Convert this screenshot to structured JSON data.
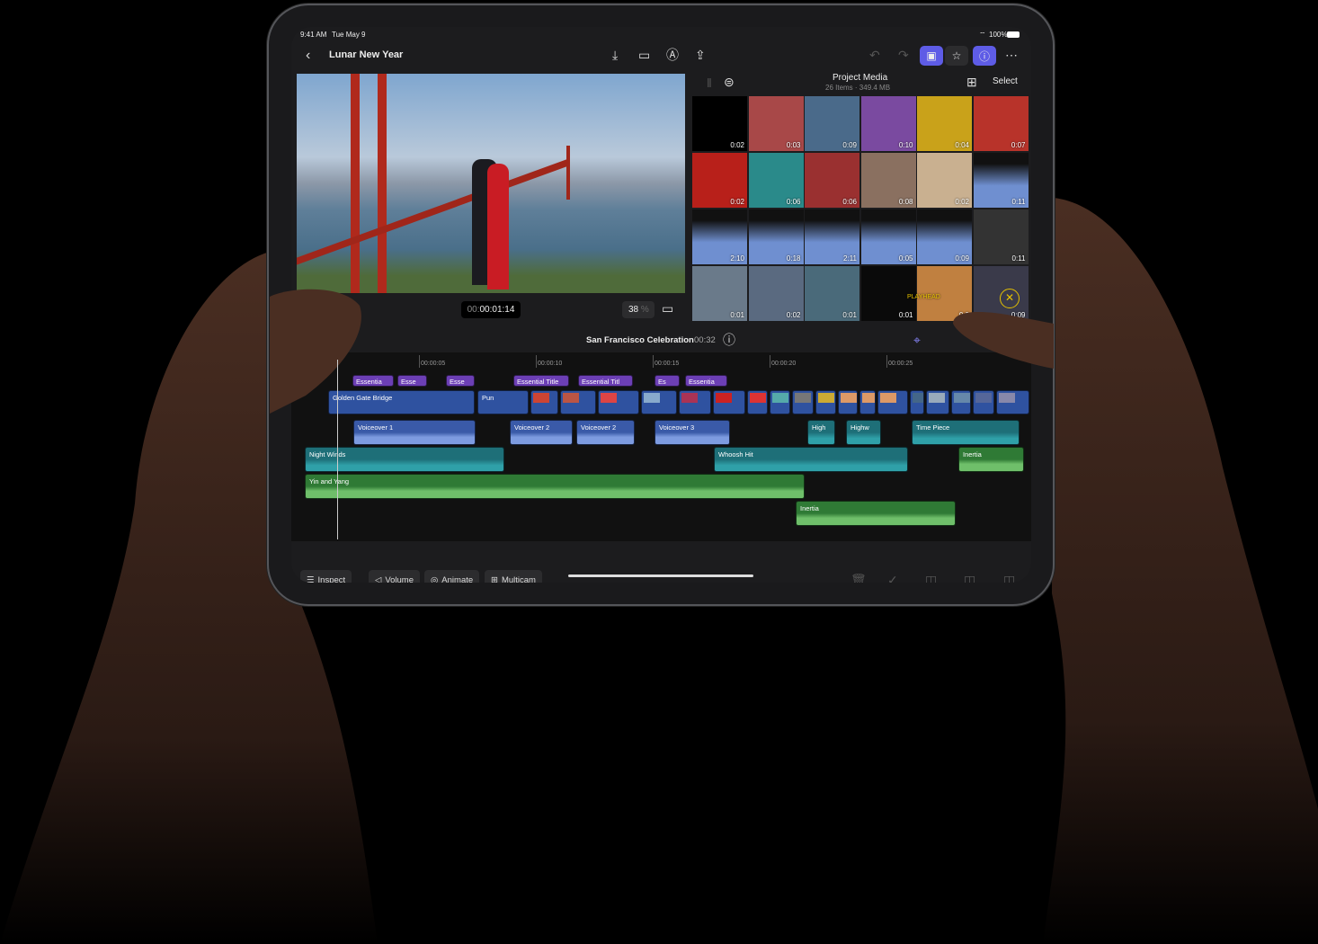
{
  "status": {
    "time": "9:41 AM",
    "date": "Tue May 9",
    "battery": "100%"
  },
  "toolbar": {
    "back": "back",
    "title": "Lunar New Year",
    "icons": [
      "import-icon",
      "camera-icon",
      "pencil-icon",
      "share-icon",
      "undo-icon",
      "redo-icon",
      "photos-icon",
      "titles-icon",
      "inspector-icon",
      "more-icon"
    ]
  },
  "viewer": {
    "timecode_dim": "00:",
    "timecode": "00:01:14",
    "zoom": "38",
    "zoom_unit": "%"
  },
  "browser": {
    "title": "Project Media",
    "subtitle": "26 Items · 349.4 MB",
    "select": "Select",
    "durations": [
      "0:02",
      "0:03",
      "0:09",
      "0:10",
      "0:04",
      "0:07",
      "0:02",
      "0:06",
      "0:06",
      "0:08",
      "0:02",
      "0:11",
      "2:10",
      "0:18",
      "2:11",
      "0:05",
      "0:09",
      "0:11",
      "0:01",
      "0:02",
      "0:01",
      "0:01",
      "0:0",
      "0:09"
    ],
    "playhead_label": "PLAYHEAD"
  },
  "timeline": {
    "project": "San Francisco Celebration",
    "duration": "00:32",
    "ruler": [
      "00:00:05",
      "00:00:10",
      "00:00:15",
      "00:00:20",
      "00:00:25"
    ],
    "titles": [
      "Essentia",
      "Esse",
      "Esse",
      "Essential Title",
      "Essential Titl",
      "Es",
      "Essentia"
    ],
    "video": [
      "Golden Gate Bridge",
      "Pun"
    ],
    "voiceovers": [
      "Voiceover 1",
      "Voiceover 2",
      "Voiceover 2",
      "Voiceover 3"
    ],
    "effects": [
      "High",
      "Highw",
      "Time Piece",
      "Night Winds",
      "Whoosh Hit"
    ],
    "music": [
      "Inertia",
      "Yin and Yang",
      "Inertia"
    ]
  },
  "bottom": {
    "inspect": "Inspect",
    "volume": "Volume",
    "animate": "Animate",
    "multicam": "Multicam"
  },
  "colors": {
    "accent": "#5e5ce6",
    "title_clip": "#6c3fb5",
    "video_clip": "#2f52a0",
    "effect_clip": "#1e6f78",
    "music_clip": "#2f7a35",
    "playhead_yellow": "#e6c200"
  }
}
